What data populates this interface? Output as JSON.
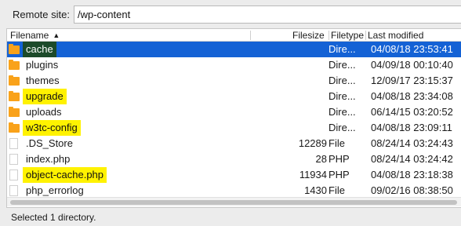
{
  "remote": {
    "label": "Remote site:",
    "path": "/wp-content"
  },
  "columns": {
    "filename": "Filename",
    "filesize": "Filesize",
    "filetype": "Filetype",
    "last_modified": "Last modified"
  },
  "files": [
    {
      "name": "cache",
      "size": "",
      "type": "Dire...",
      "modified": "04/08/18 23:53:41",
      "icon": "folder-icon",
      "highlighted": true,
      "selected": true
    },
    {
      "name": "plugins",
      "size": "",
      "type": "Dire...",
      "modified": "04/09/18 00:10:40",
      "icon": "folder-icon",
      "highlighted": false,
      "selected": false
    },
    {
      "name": "themes",
      "size": "",
      "type": "Dire...",
      "modified": "12/09/17 23:15:37",
      "icon": "folder-icon",
      "highlighted": false,
      "selected": false
    },
    {
      "name": "upgrade",
      "size": "",
      "type": "Dire...",
      "modified": "04/08/18 23:34:08",
      "icon": "folder-icon",
      "highlighted": true,
      "selected": false
    },
    {
      "name": "uploads",
      "size": "",
      "type": "Dire...",
      "modified": "06/14/15 03:20:52",
      "icon": "folder-icon",
      "highlighted": false,
      "selected": false
    },
    {
      "name": "w3tc-config",
      "size": "",
      "type": "Dire...",
      "modified": "04/08/18 23:09:11",
      "icon": "folder-icon",
      "highlighted": true,
      "selected": false
    },
    {
      "name": ".DS_Store",
      "size": "12289",
      "type": "File",
      "modified": "08/24/14 03:24:43",
      "icon": "file-icon",
      "highlighted": false,
      "selected": false
    },
    {
      "name": "index.php",
      "size": "28",
      "type": "PHP",
      "modified": "08/24/14 03:24:42",
      "icon": "file-icon",
      "highlighted": false,
      "selected": false
    },
    {
      "name": "object-cache.php",
      "size": "11934",
      "type": "PHP",
      "modified": "04/08/18 23:18:38",
      "icon": "file-icon",
      "highlighted": true,
      "selected": false
    },
    {
      "name": "php_errorlog",
      "size": "1430",
      "type": "File",
      "modified": "09/02/16 08:38:50",
      "icon": "file-icon",
      "highlighted": false,
      "selected": false
    }
  ],
  "status": "Selected 1 directory."
}
